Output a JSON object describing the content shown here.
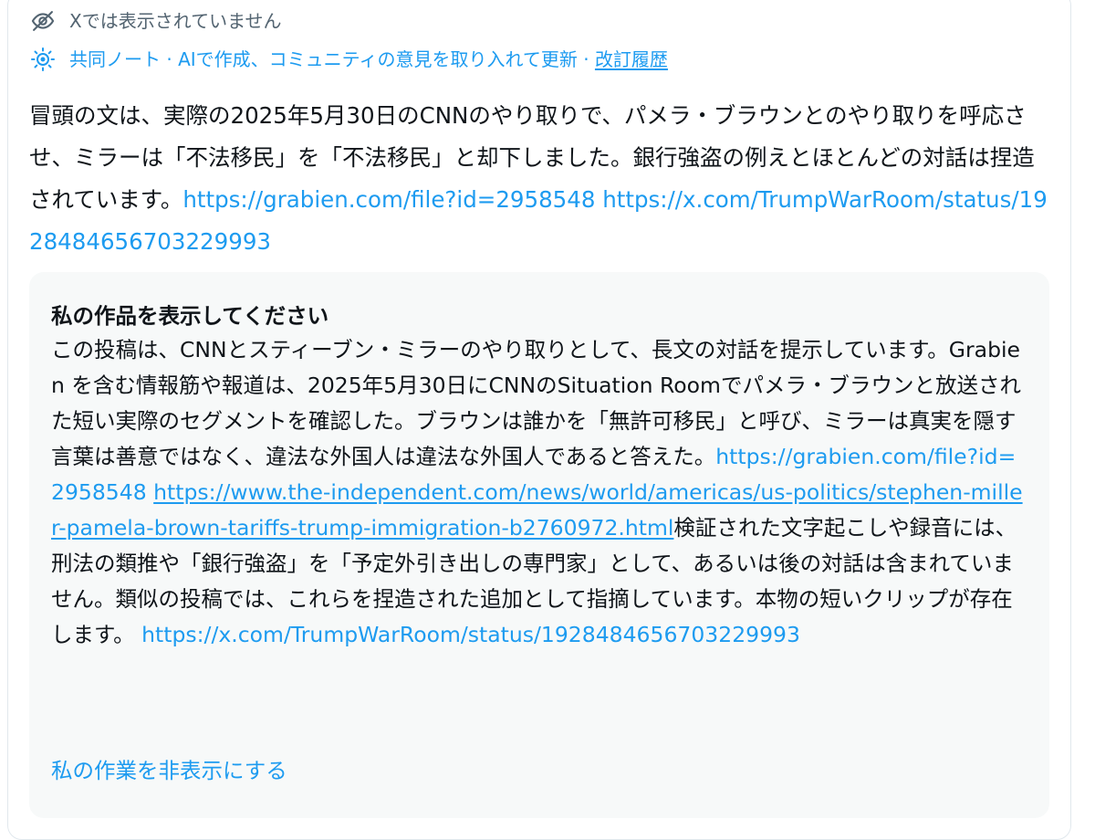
{
  "status": {
    "hidden_label": "Xでは表示されていません",
    "icon": "eye-slash-icon"
  },
  "note_meta": {
    "icon": "community-note-icon",
    "text": "共同ノート · AIで作成、コミュニティの意見を取り入れて更新 · ",
    "history_link": "改訂履歴"
  },
  "note": {
    "text": "冒頭の文は、実際の2025年5月30日のCNNのやり取りで、パメラ・ブラウンとのやり取りを呼応させ、ミラーは「不法移民」を「不法移民」と却下しました。銀行強盗の例えとほとんどの対話は捏造されています。",
    "link1": "https://grabien.com/file?id=2958548",
    "link2": "https://x.com/TrumpWarRoom/status/1928484656703229993"
  },
  "work": {
    "title": "私の作品を表示してください",
    "text1": "この投稿は、CNNとスティーブン・ミラーのやり取りとして、長文の対話を提示しています。Grabien を含む情報筋や報道は、2025年5月30日にCNNのSituation Roomでパメラ・ブラウンと放送された短い実際のセグメントを確認した。ブラウンは誰かを「無許可移民」と呼び、ミラーは真実を隠す言葉は善意ではなく、違法な外国人は違法な外国人であると答えた。",
    "link1": "https://grabien.com/file?id=2958548",
    "link2": "https://www.the-independent.com/news/world/americas/us-politics/stephen-miller-pamela-brown-tariffs-trump-immigration-b2760972.html",
    "text2": "検証された文字起こしや録音には、刑法の類推や「銀行強盗」を「予定外引き出しの専門家」として、あるいは後の対話は含まれていません。類似の投稿では、これらを捏造された追加として指摘しています。本物の短いクリップが存在します。",
    "link3": "https://x.com/TrumpWarRoom/status/1928484656703229993",
    "hide_label": "私の作業を非表示にする"
  },
  "colors": {
    "accent": "#1d9bf0",
    "muted": "#536471",
    "text": "#0f1419",
    "panel_bg": "#f7f9f9"
  }
}
